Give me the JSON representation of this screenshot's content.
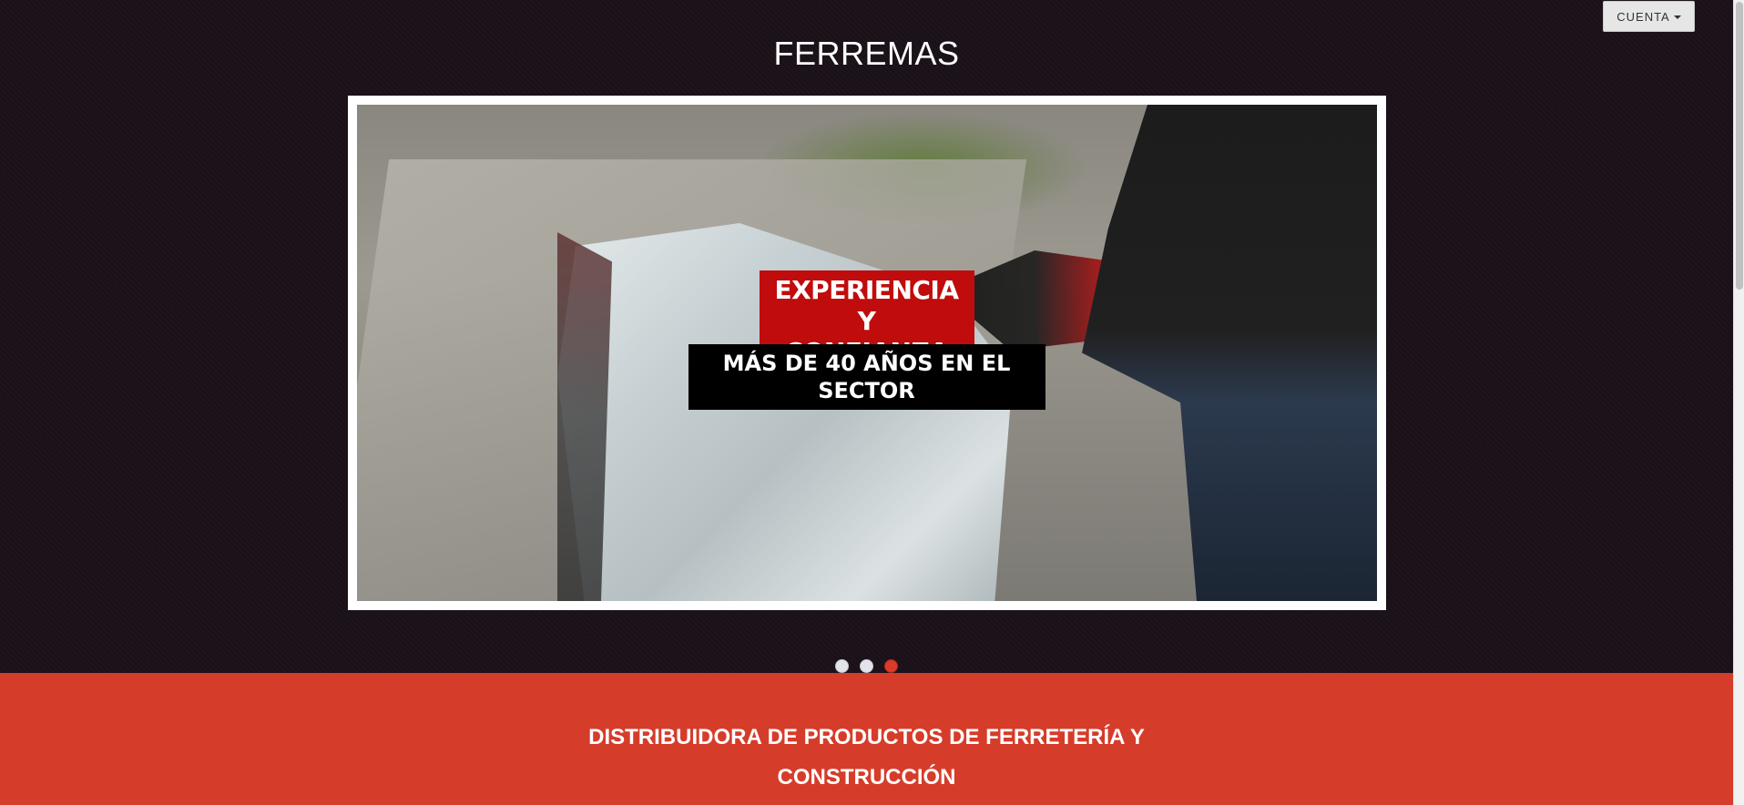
{
  "header": {
    "site_title": "FERREMAS",
    "account_menu_label": "CUENTA"
  },
  "carousel": {
    "active_slide": 3,
    "slide_count": 3,
    "caption_title": "EXPERIENCIA Y CONFIANZA",
    "caption_subtitle": "MÁS DE 40 AÑOS EN EL SECTOR"
  },
  "banner": {
    "text": "DISTRIBUIDORA DE PRODUCTOS DE FERRETERÍA Y CONSTRUCCIÓN"
  },
  "colors": {
    "background": "#1b1119",
    "banner": "#d63c2a",
    "caption_red": "#c00c0c",
    "active_indicator": "#d93c2a"
  }
}
